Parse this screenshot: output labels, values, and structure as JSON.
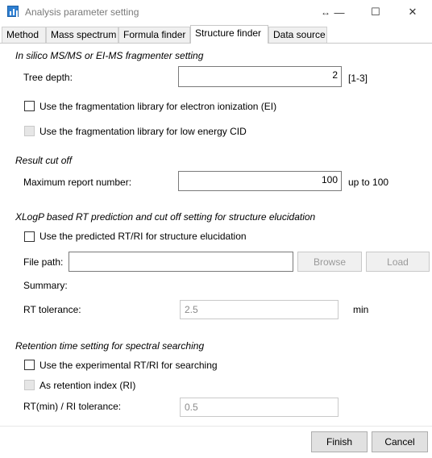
{
  "window": {
    "title": "Analysis parameter setting",
    "resize_glyph": "↔",
    "minimize_glyph": "—",
    "maximize_glyph": "☐",
    "close_glyph": "✕"
  },
  "tabs": [
    {
      "label": "Method"
    },
    {
      "label": "Mass spectrum"
    },
    {
      "label": "Formula finder"
    },
    {
      "label": "Structure finder"
    },
    {
      "label": "Data source"
    }
  ],
  "fragmenter": {
    "heading": "In silico MS/MS or EI-MS fragmenter setting",
    "tree_depth_label": "Tree depth:",
    "tree_depth_value": "2",
    "tree_depth_range": "[1-3]",
    "use_ei_label": "Use the fragmentation library for electron ionization (EI)",
    "use_ei_checked": false,
    "use_cid_label": "Use the fragmentation library for low energy CID",
    "use_cid_checked": false
  },
  "result_cutoff": {
    "heading": "Result cut off",
    "max_report_label": "Maximum report number:",
    "max_report_value": "100",
    "max_report_hint": "up to 100"
  },
  "rt_prediction": {
    "heading": "XLogP based RT prediction and cut off setting for structure elucidation",
    "use_predicted_label": "Use the predicted RT/RI for structure elucidation",
    "use_predicted_checked": false,
    "file_path_label": "File path:",
    "file_path_value": "",
    "browse_label": "Browse",
    "load_label": "Load",
    "summary_label": "Summary:",
    "rt_tolerance_label": "RT tolerance:",
    "rt_tolerance_value": "2.5",
    "rt_tolerance_unit": "min"
  },
  "retention": {
    "heading": "Retention time setting for spectral searching",
    "use_experimental_label": "Use the experimental RT/RI for searching",
    "use_experimental_checked": false,
    "as_ri_label": "As retention index (RI)",
    "as_ri_checked": false,
    "tolerance_label": "RT(min) / RI tolerance:",
    "tolerance_value": "0.5"
  },
  "footer": {
    "finish_label": "Finish",
    "cancel_label": "Cancel"
  }
}
